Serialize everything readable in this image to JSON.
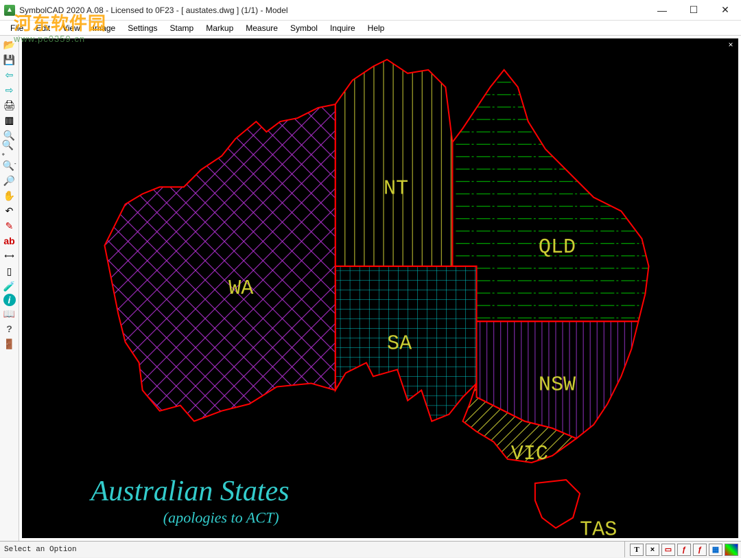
{
  "window": {
    "title": "SymbolCAD 2020 A.08 - Licensed to 0F23 -  [ austates.dwg ] (1/1)  -  Model",
    "minimize": "—",
    "maximize": "☐",
    "close": "✕"
  },
  "menu": {
    "file": "File",
    "edit": "Edit",
    "view": "View",
    "image": "Image",
    "settings": "Settings",
    "stamp": "Stamp",
    "markup": "Markup",
    "measure": "Measure",
    "symbol": "Symbol",
    "inquire": "Inquire",
    "help": "Help"
  },
  "toolbar": {
    "open": "open-folder-icon",
    "save": "save-icon",
    "prev": "arrow-left-icon",
    "next": "arrow-right-icon",
    "print": "printer-icon",
    "sheet": "sheet-icon",
    "zoom": "zoom-icon",
    "zoom_in": "zoom-in-icon",
    "zoom_out": "zoom-out-icon",
    "zoom_window": "zoom-window-icon",
    "pan": "pan-icon",
    "undo": "undo-icon",
    "pencil": "pencil-icon",
    "text_tool": "ab",
    "dim": "dimension-icon",
    "stamp": "stamp-icon",
    "lab": "lab-icon",
    "info": "info-icon",
    "book": "book-icon",
    "help": "?",
    "exit": "exit-icon"
  },
  "canvas": {
    "close": "×",
    "labels": {
      "wa": "WA",
      "nt": "NT",
      "qld": "QLD",
      "sa": "SA",
      "nsw": "NSW",
      "vic": "VIC",
      "tas": "TAS"
    },
    "title": "Australian States",
    "subtitle": "(apologies to ACT)"
  },
  "status": {
    "message": "Select an Option",
    "indicators": {
      "text": "T",
      "close": "×",
      "rect": "▭",
      "z1": "ƒ",
      "z2": "ƒ",
      "grid": "▦",
      "color": "▦"
    }
  },
  "watermark": {
    "line1": "河东软件园",
    "line2": "www.pc0359.cn"
  }
}
